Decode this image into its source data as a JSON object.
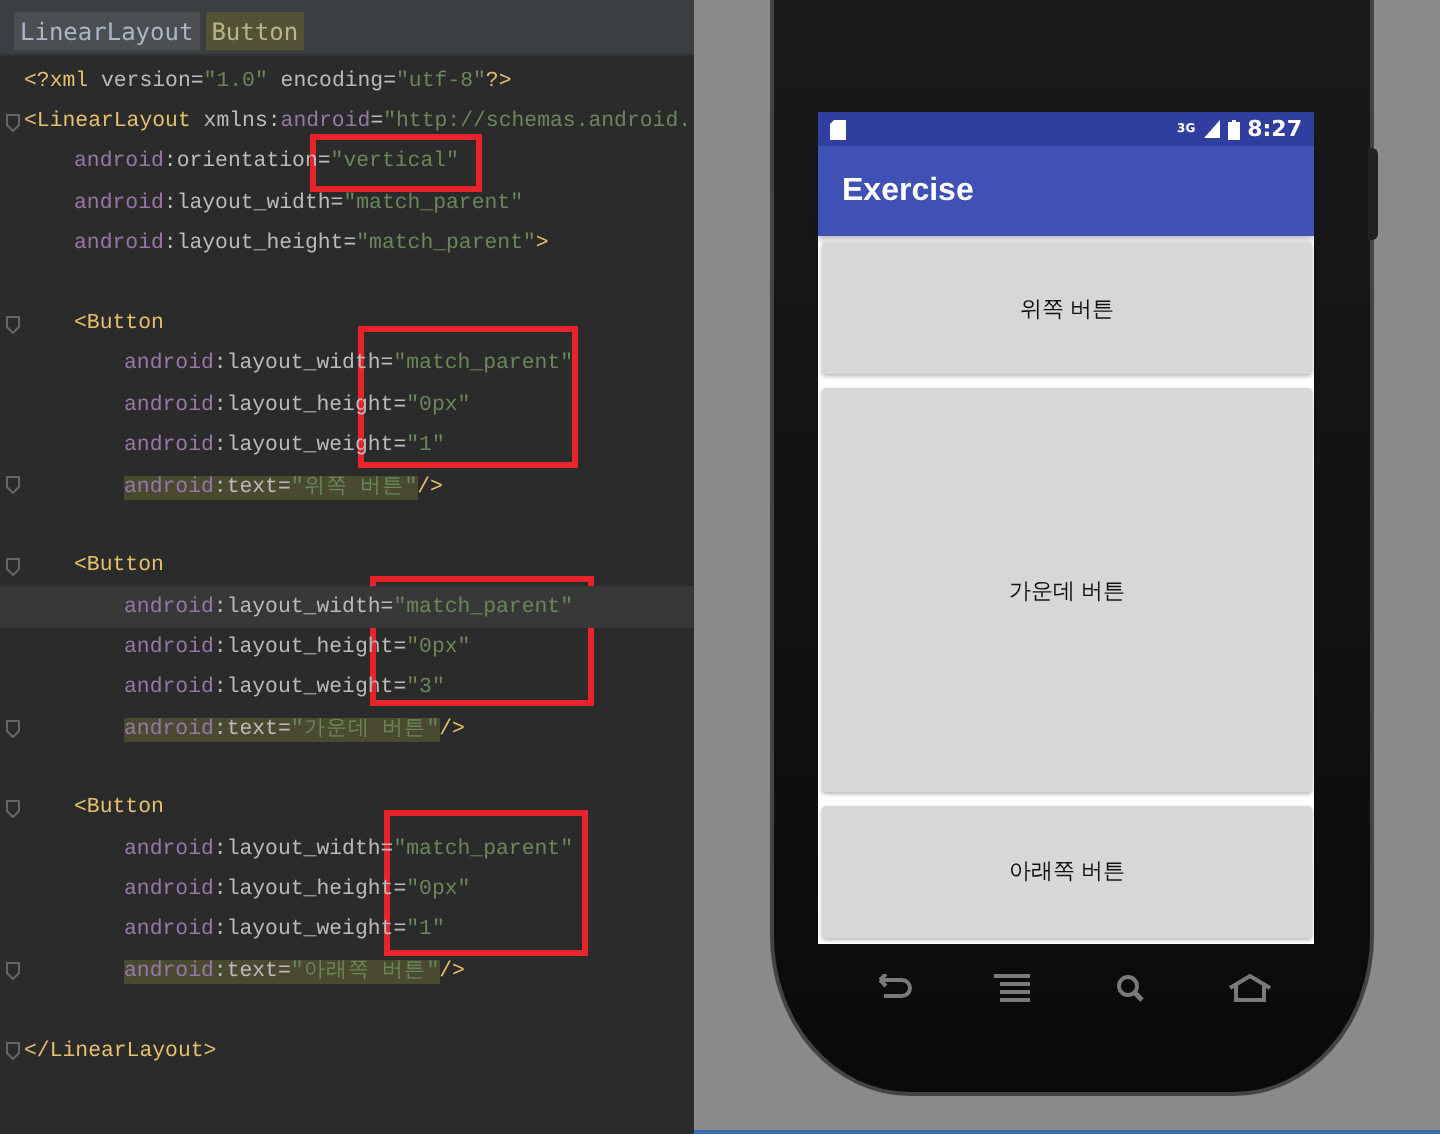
{
  "editor": {
    "breadcrumbs": [
      {
        "label": "LinearLayout",
        "selected": false
      },
      {
        "label": "Button",
        "selected": true
      }
    ],
    "lines": [
      {
        "kind": "decl",
        "current": false,
        "blank_before": false,
        "tokens": [
          {
            "kind": "tag",
            "text": "<?xml "
          },
          {
            "kind": "attr",
            "text": "version="
          },
          {
            "kind": "value",
            "text": "\"1.0\""
          },
          {
            "kind": "attr",
            "text": " encoding="
          },
          {
            "kind": "value",
            "text": "\"utf-8\""
          },
          {
            "kind": "tag",
            "text": "?>"
          }
        ]
      },
      {
        "kind": "open",
        "current": false,
        "blank_before": false,
        "tokens": [
          {
            "kind": "tag",
            "text": "<LinearLayout "
          },
          {
            "kind": "attr",
            "text": "xmlns:"
          },
          {
            "kind": "ns",
            "text": "android"
          },
          {
            "kind": "attr",
            "text": "="
          },
          {
            "kind": "value",
            "text": "\"http://schemas.android."
          }
        ],
        "children": [
          {
            "kind": "attr",
            "current": false,
            "blank_before": false,
            "tokens": [
              {
                "kind": "ns",
                "text": "android"
              },
              {
                "kind": "attr",
                "text": ":orientation="
              },
              {
                "kind": "value",
                "text": "\"vertical\""
              }
            ]
          },
          {
            "kind": "attr",
            "current": false,
            "blank_before": false,
            "tokens": [
              {
                "kind": "ns",
                "text": "android"
              },
              {
                "kind": "attr",
                "text": ":layout_width="
              },
              {
                "kind": "value",
                "text": "\"match_parent\""
              }
            ]
          },
          {
            "kind": "attr",
            "current": false,
            "blank_before": false,
            "tokens": [
              {
                "kind": "ns",
                "text": "android"
              },
              {
                "kind": "attr",
                "text": ":layout_height="
              },
              {
                "kind": "value",
                "text": "\"match_parent\""
              },
              {
                "kind": "tag",
                "text": ">"
              }
            ]
          },
          {
            "kind": "open",
            "current": false,
            "blank_before": true,
            "tokens": [
              {
                "kind": "tag",
                "text": "<Button"
              }
            ],
            "children": [
              {
                "kind": "attr",
                "current": false,
                "blank_before": false,
                "tokens": [
                  {
                    "kind": "ns",
                    "text": "android"
                  },
                  {
                    "kind": "attr",
                    "text": ":layout_width="
                  },
                  {
                    "kind": "value",
                    "text": "\"match_parent\""
                  }
                ]
              },
              {
                "kind": "attr",
                "current": false,
                "blank_before": false,
                "tokens": [
                  {
                    "kind": "ns",
                    "text": "android"
                  },
                  {
                    "kind": "attr",
                    "text": ":layout_height="
                  },
                  {
                    "kind": "value",
                    "text": "\"0px\""
                  }
                ]
              },
              {
                "kind": "attr",
                "current": false,
                "blank_before": false,
                "tokens": [
                  {
                    "kind": "ns",
                    "text": "android"
                  },
                  {
                    "kind": "attr",
                    "text": ":layout_weight="
                  },
                  {
                    "kind": "value",
                    "text": "\"1\""
                  }
                ]
              },
              {
                "kind": "text-attr",
                "current": false,
                "blank_before": false,
                "tokens": [
                  {
                    "kind": "ns",
                    "text": "android"
                  },
                  {
                    "kind": "attr",
                    "text": ":text="
                  },
                  {
                    "kind": "value",
                    "text": "\"위쪽 버튼\""
                  },
                  {
                    "kind": "close",
                    "text": "/>"
                  }
                ]
              }
            ]
          },
          {
            "kind": "open",
            "current": false,
            "blank_before": true,
            "tokens": [
              {
                "kind": "tag",
                "text": "<Button"
              }
            ],
            "children": [
              {
                "kind": "attr",
                "current": true,
                "blank_before": false,
                "tokens": [
                  {
                    "kind": "ns",
                    "text": "android"
                  },
                  {
                    "kind": "attr",
                    "text": ":layout_width="
                  },
                  {
                    "kind": "value",
                    "text": "\"match_parent\""
                  }
                ]
              },
              {
                "kind": "attr",
                "current": false,
                "blank_before": false,
                "tokens": [
                  {
                    "kind": "ns",
                    "text": "android"
                  },
                  {
                    "kind": "attr",
                    "text": ":layout_height="
                  },
                  {
                    "kind": "value",
                    "text": "\"0px\""
                  }
                ]
              },
              {
                "kind": "attr",
                "current": false,
                "blank_before": false,
                "tokens": [
                  {
                    "kind": "ns",
                    "text": "android"
                  },
                  {
                    "kind": "attr",
                    "text": ":layout_weight="
                  },
                  {
                    "kind": "value",
                    "text": "\"3\""
                  }
                ]
              },
              {
                "kind": "text-attr",
                "current": false,
                "blank_before": false,
                "tokens": [
                  {
                    "kind": "ns",
                    "text": "android"
                  },
                  {
                    "kind": "attr",
                    "text": ":text="
                  },
                  {
                    "kind": "value",
                    "text": "\"가운데 버튼\""
                  },
                  {
                    "kind": "close",
                    "text": "/>"
                  }
                ]
              }
            ]
          },
          {
            "kind": "open",
            "current": false,
            "blank_before": true,
            "tokens": [
              {
                "kind": "tag",
                "text": "<Button"
              }
            ],
            "children": [
              {
                "kind": "attr",
                "current": false,
                "blank_before": false,
                "tokens": [
                  {
                    "kind": "ns",
                    "text": "android"
                  },
                  {
                    "kind": "attr",
                    "text": ":layout_width="
                  },
                  {
                    "kind": "value",
                    "text": "\"match_parent\""
                  }
                ]
              },
              {
                "kind": "attr",
                "current": false,
                "blank_before": false,
                "tokens": [
                  {
                    "kind": "ns",
                    "text": "android"
                  },
                  {
                    "kind": "attr",
                    "text": ":layout_height="
                  },
                  {
                    "kind": "value",
                    "text": "\"0px\""
                  }
                ]
              },
              {
                "kind": "attr",
                "current": false,
                "blank_before": false,
                "tokens": [
                  {
                    "kind": "ns",
                    "text": "android"
                  },
                  {
                    "kind": "attr",
                    "text": ":layout_weight="
                  },
                  {
                    "kind": "value",
                    "text": "\"1\""
                  }
                ]
              },
              {
                "kind": "text-attr",
                "current": false,
                "blank_before": false,
                "tokens": [
                  {
                    "kind": "ns",
                    "text": "android"
                  },
                  {
                    "kind": "attr",
                    "text": ":text="
                  },
                  {
                    "kind": "value",
                    "text": "\"아래쪽 버튼\""
                  },
                  {
                    "kind": "close",
                    "text": "/>"
                  }
                ]
              }
            ]
          }
        ]
      },
      {
        "kind": "close",
        "current": false,
        "blank_before": true,
        "tokens": [
          {
            "kind": "tag",
            "text": "</LinearLayout>"
          }
        ]
      }
    ]
  },
  "preview": {
    "status_bar": {
      "network": "3G",
      "time": "8:27"
    },
    "app_bar": {
      "title": "Exercise"
    },
    "buttons": [
      {
        "label": "위쪽 버튼"
      },
      {
        "label": "가운데 버튼"
      },
      {
        "label": "아래쪽 버튼"
      }
    ]
  }
}
